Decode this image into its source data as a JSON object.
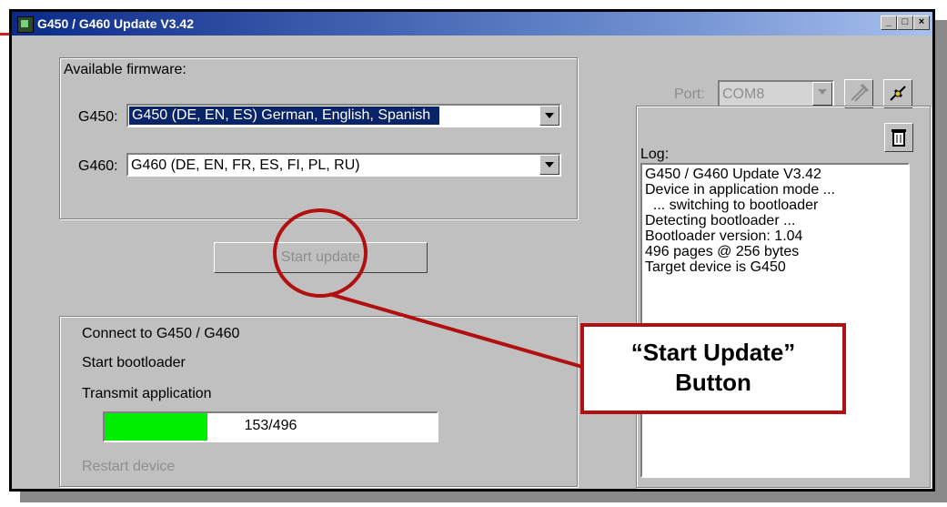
{
  "window": {
    "title": "G450 / G460 Update V3.42",
    "minimize": "_",
    "maximize": "□",
    "close": "×"
  },
  "firmware": {
    "group_label": "Available firmware:",
    "g450_label": "G450:",
    "g450_value": "G450 (DE, EN, ES)   German, English, Spanish",
    "g460_label": "G460:",
    "g460_value": "G460 (DE, EN, FR, ES, FI, PL, RU)"
  },
  "start_button": "Start update",
  "steps": {
    "connect": "Connect to G450 / G460",
    "bootloader": "Start bootloader",
    "transmit": "Transmit application",
    "restart": "Restart device"
  },
  "progress": {
    "text": "153/496",
    "fraction": 0.3085
  },
  "port": {
    "label": "Port:",
    "value": "COM8"
  },
  "log": {
    "label": "Log:",
    "lines": [
      "G450 / G460 Update V3.42",
      "Device in application mode ...",
      "  ... switching to bootloader",
      "Detecting bootloader ...",
      "Bootloader version: 1.04",
      "496 pages @ 256 bytes",
      "Target device is G450"
    ]
  },
  "callout": {
    "line1": "“Start Update”",
    "line2": "Button"
  },
  "colors": {
    "callout": "#b01010",
    "progress": "#00ee00",
    "title_bar": "#0a2a8a"
  },
  "icons": [
    "connect-icon",
    "disconnect-icon",
    "trash-icon"
  ]
}
